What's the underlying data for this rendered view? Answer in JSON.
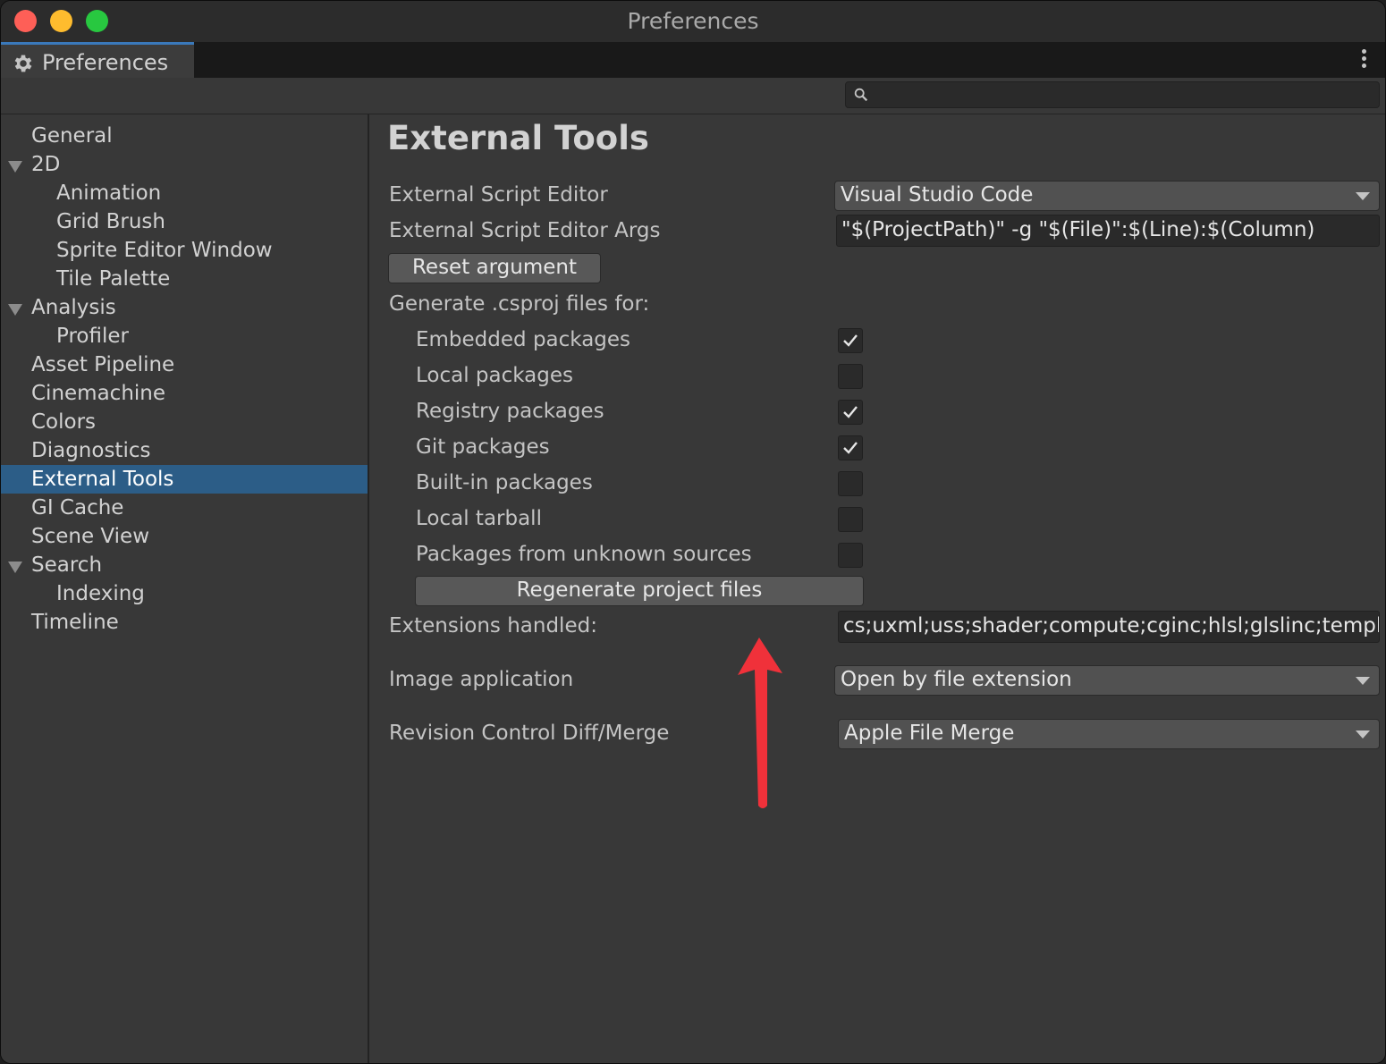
{
  "window": {
    "title": "Preferences"
  },
  "tab": {
    "label": "Preferences",
    "icon": "gear-icon"
  },
  "search": {
    "value": "",
    "icon": "search-icon"
  },
  "sidebar": {
    "items": [
      {
        "label": "General",
        "expandable": false,
        "indent": 0
      },
      {
        "label": "2D",
        "expandable": true,
        "indent": 0
      },
      {
        "label": "Animation",
        "expandable": false,
        "indent": 1
      },
      {
        "label": "Grid Brush",
        "expandable": false,
        "indent": 1
      },
      {
        "label": "Sprite Editor Window",
        "expandable": false,
        "indent": 1
      },
      {
        "label": "Tile Palette",
        "expandable": false,
        "indent": 1
      },
      {
        "label": "Analysis",
        "expandable": true,
        "indent": 0
      },
      {
        "label": "Profiler",
        "expandable": false,
        "indent": 1
      },
      {
        "label": "Asset Pipeline",
        "expandable": false,
        "indent": 0
      },
      {
        "label": "Cinemachine",
        "expandable": false,
        "indent": 0
      },
      {
        "label": "Colors",
        "expandable": false,
        "indent": 0
      },
      {
        "label": "Diagnostics",
        "expandable": false,
        "indent": 0
      },
      {
        "label": "External Tools",
        "expandable": false,
        "indent": 0,
        "selected": true
      },
      {
        "label": "GI Cache",
        "expandable": false,
        "indent": 0
      },
      {
        "label": "Scene View",
        "expandable": false,
        "indent": 0
      },
      {
        "label": "Search",
        "expandable": true,
        "indent": 0
      },
      {
        "label": "Indexing",
        "expandable": false,
        "indent": 1
      },
      {
        "label": "Timeline",
        "expandable": false,
        "indent": 0
      }
    ]
  },
  "main": {
    "title": "External Tools",
    "script_editor": {
      "label": "External Script Editor",
      "value": "Visual Studio Code"
    },
    "script_editor_args": {
      "label": "External Script Editor Args",
      "value": "\"$(ProjectPath)\" -g \"$(File)\":$(Line):$(Column)"
    },
    "reset_button": "Reset argument",
    "csproj_heading": "Generate .csproj files for:",
    "packages": [
      {
        "label": "Embedded packages",
        "checked": true
      },
      {
        "label": "Local packages",
        "checked": false
      },
      {
        "label": "Registry packages",
        "checked": true
      },
      {
        "label": "Git packages",
        "checked": true
      },
      {
        "label": "Built-in packages",
        "checked": false
      },
      {
        "label": "Local tarball",
        "checked": false
      },
      {
        "label": "Packages from unknown sources",
        "checked": false
      }
    ],
    "regenerate_button": "Regenerate project files",
    "extensions": {
      "label": "Extensions handled:",
      "value": "cs;uxml;uss;shader;compute;cginc;hlsl;glslinc;template;raytrace"
    },
    "image_application": {
      "label": "Image application",
      "value": "Open by file extension"
    },
    "diff_merge": {
      "label": "Revision Control Diff/Merge",
      "value": "Apple File Merge"
    }
  },
  "colors": {
    "selection": "#2c5d87",
    "annotation_arrow": "#f0313a"
  }
}
